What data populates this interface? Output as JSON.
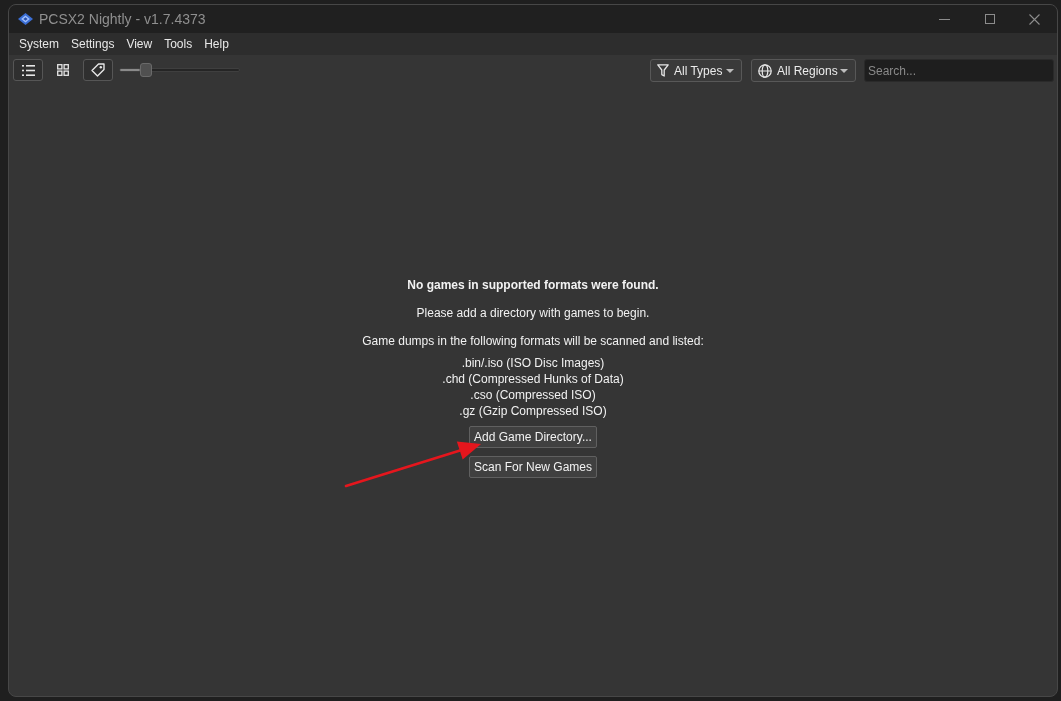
{
  "window": {
    "title": "PCSX2 Nightly - v1.7.4373"
  },
  "menu": [
    "System",
    "Settings",
    "View",
    "Tools",
    "Help"
  ],
  "toolbar": {
    "view_buttons": [
      {
        "kind": "list",
        "selected": true
      },
      {
        "kind": "grid",
        "selected": false
      }
    ],
    "title_toggle": {
      "checked": true
    },
    "zoom_slider": {
      "level": 0.18
    },
    "type_filter": {
      "value": "All Types"
    },
    "region_filter": {
      "value": "All Regions"
    },
    "search": {
      "placeholder": "Search..."
    }
  },
  "empty_state": {
    "heading": "No games in supported formats were found.",
    "message": "Please add a directory with games to begin.",
    "formats_intro": "Game dumps in the following formats will be scanned and listed:",
    "formats": [
      ".bin/.iso (ISO Disc Images)",
      ".chd (Compressed Hunks of Data)",
      ".cso (Compressed ISO)",
      ".gz (Gzip Compressed ISO)"
    ],
    "add_directory_button": "Add Game Directory...",
    "scan_button": "Scan For New Games"
  }
}
